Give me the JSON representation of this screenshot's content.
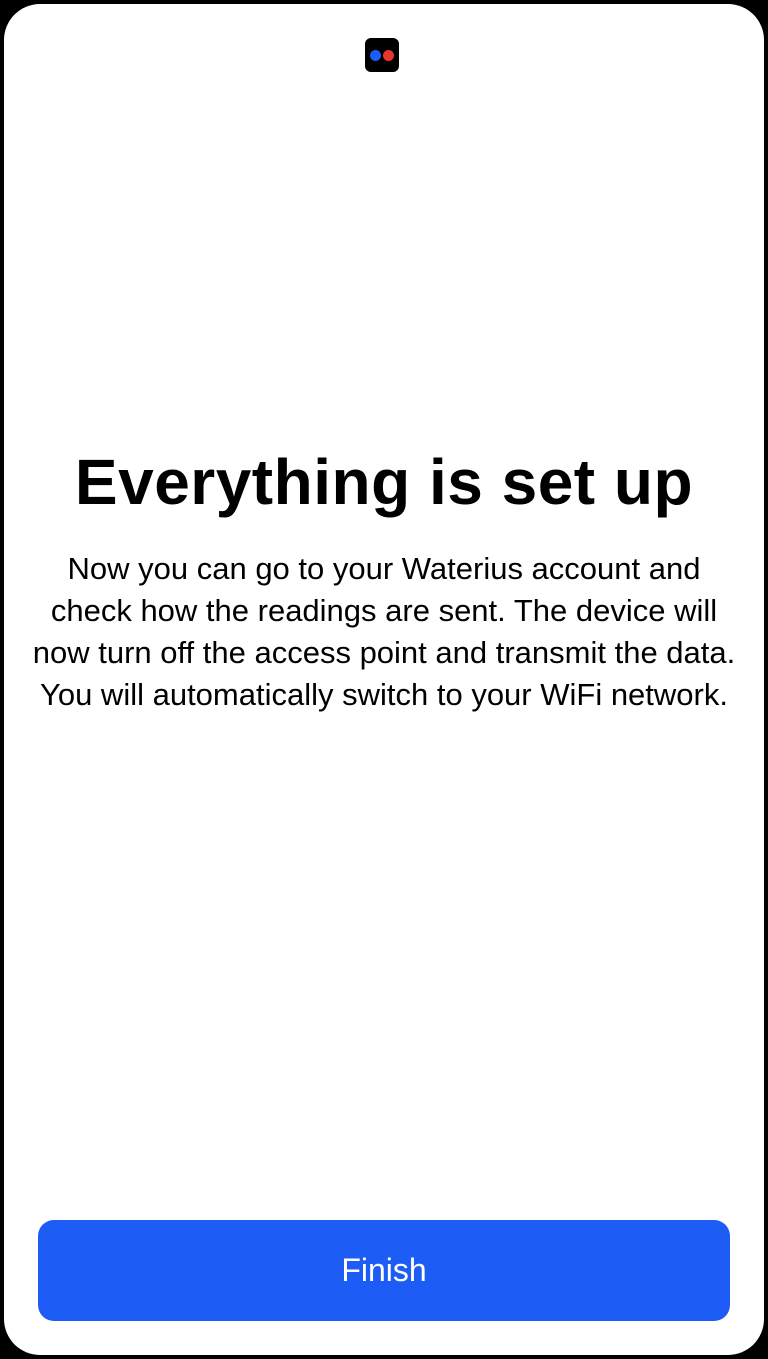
{
  "app": {
    "logo_icon": "waterius-logo-icon",
    "logo_colors": [
      "#1d5cf5",
      "#e8362a"
    ]
  },
  "main": {
    "title": "Everything is set up",
    "description": "Now you can go to your Waterius account and check how the readings are sent. The device will now turn off the access point and transmit the data. You will automatically switch to your WiFi network."
  },
  "footer": {
    "finish_label": "Finish",
    "button_color": "#1d5cf5"
  }
}
